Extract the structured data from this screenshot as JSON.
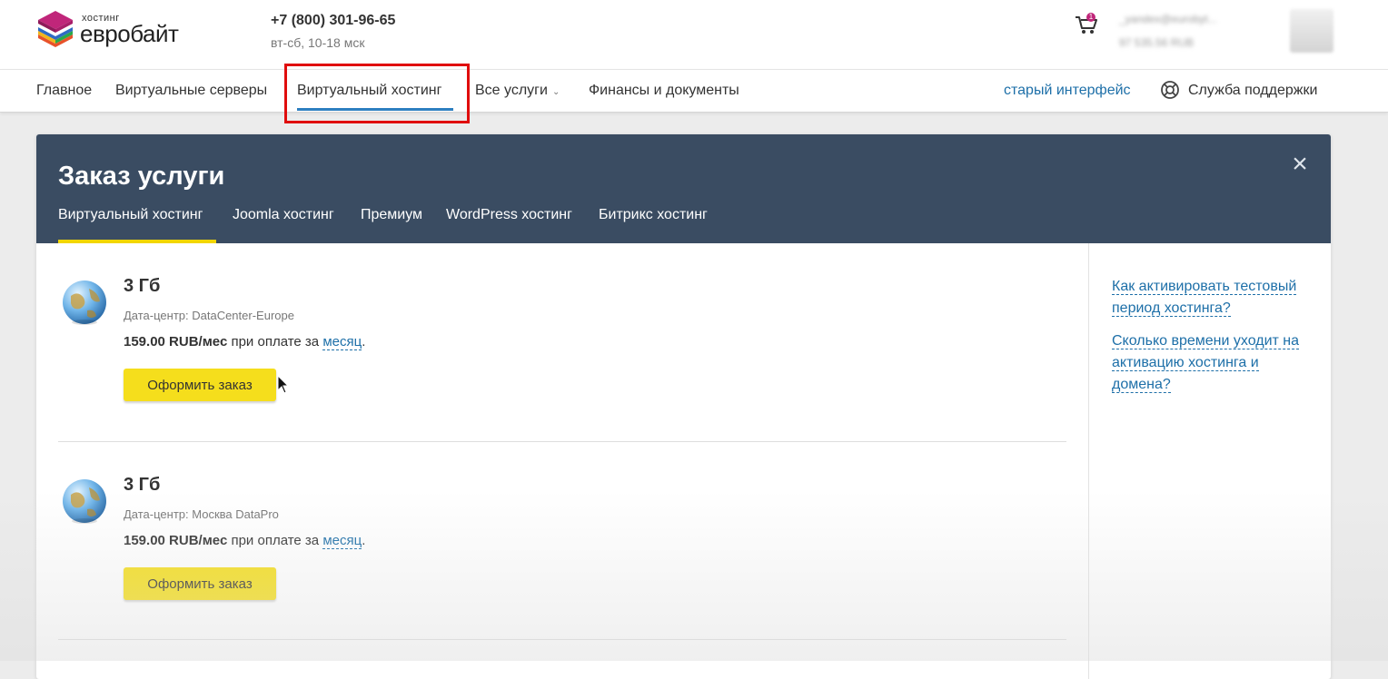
{
  "header": {
    "logo_top": "хостинг",
    "logo_main": "евробайт",
    "phone": "+7 (800) 301-96-65",
    "hours": "вт-сб, 10-18 мск",
    "cart_count": "1",
    "account_email": "_yandex@eurobyt...",
    "account_balance": "97 535.56 RUB"
  },
  "nav": {
    "items": [
      {
        "label": "Главное"
      },
      {
        "label": "Виртуальные серверы"
      },
      {
        "label": "Виртуальный хостинг",
        "active": true
      },
      {
        "label": "Все услуги"
      },
      {
        "label": "Финансы и документы"
      }
    ],
    "old_interface": "старый интерфейс",
    "support": "Служба поддержки"
  },
  "modal": {
    "title": "Заказ услуги",
    "tabs": [
      {
        "label": "Виртуальный хостинг",
        "active": true
      },
      {
        "label": "Joomla хостинг"
      },
      {
        "label": "Премиум"
      },
      {
        "label": "WordPress хостинг"
      },
      {
        "label": "Битрикс хостинг"
      }
    ],
    "plans": [
      {
        "title": "3 Гб",
        "datacenter": "Дата-центр: DataCenter-Europe",
        "price": "159.00 RUB/мес",
        "price_suffix": " при оплате за ",
        "period": "месяц",
        "period_end": ".",
        "button": "Оформить заказ"
      },
      {
        "title": "3 Гб",
        "datacenter": "Дата-центр: Москва DataPro",
        "price": "159.00 RUB/мес",
        "price_suffix": " при оплате за ",
        "period": "месяц",
        "period_end": ".",
        "button": "Оформить заказ"
      }
    ],
    "faq": [
      "Как активировать тестовый период хостинга?",
      "Сколько времени уходит на активацию хостинга и домена?"
    ]
  },
  "colors": {
    "modal_header": "#3a4c62",
    "accent_link": "#1d6fa8",
    "button_yellow": "#f5de1c",
    "tab_underline": "#f2d600",
    "highlight_red": "#e00d0d"
  },
  "icons": [
    "logo-icon",
    "cart-icon",
    "lifebuoy-icon",
    "close-icon",
    "globe-icon",
    "chevron-down-icon",
    "mouse-cursor-icon"
  ]
}
